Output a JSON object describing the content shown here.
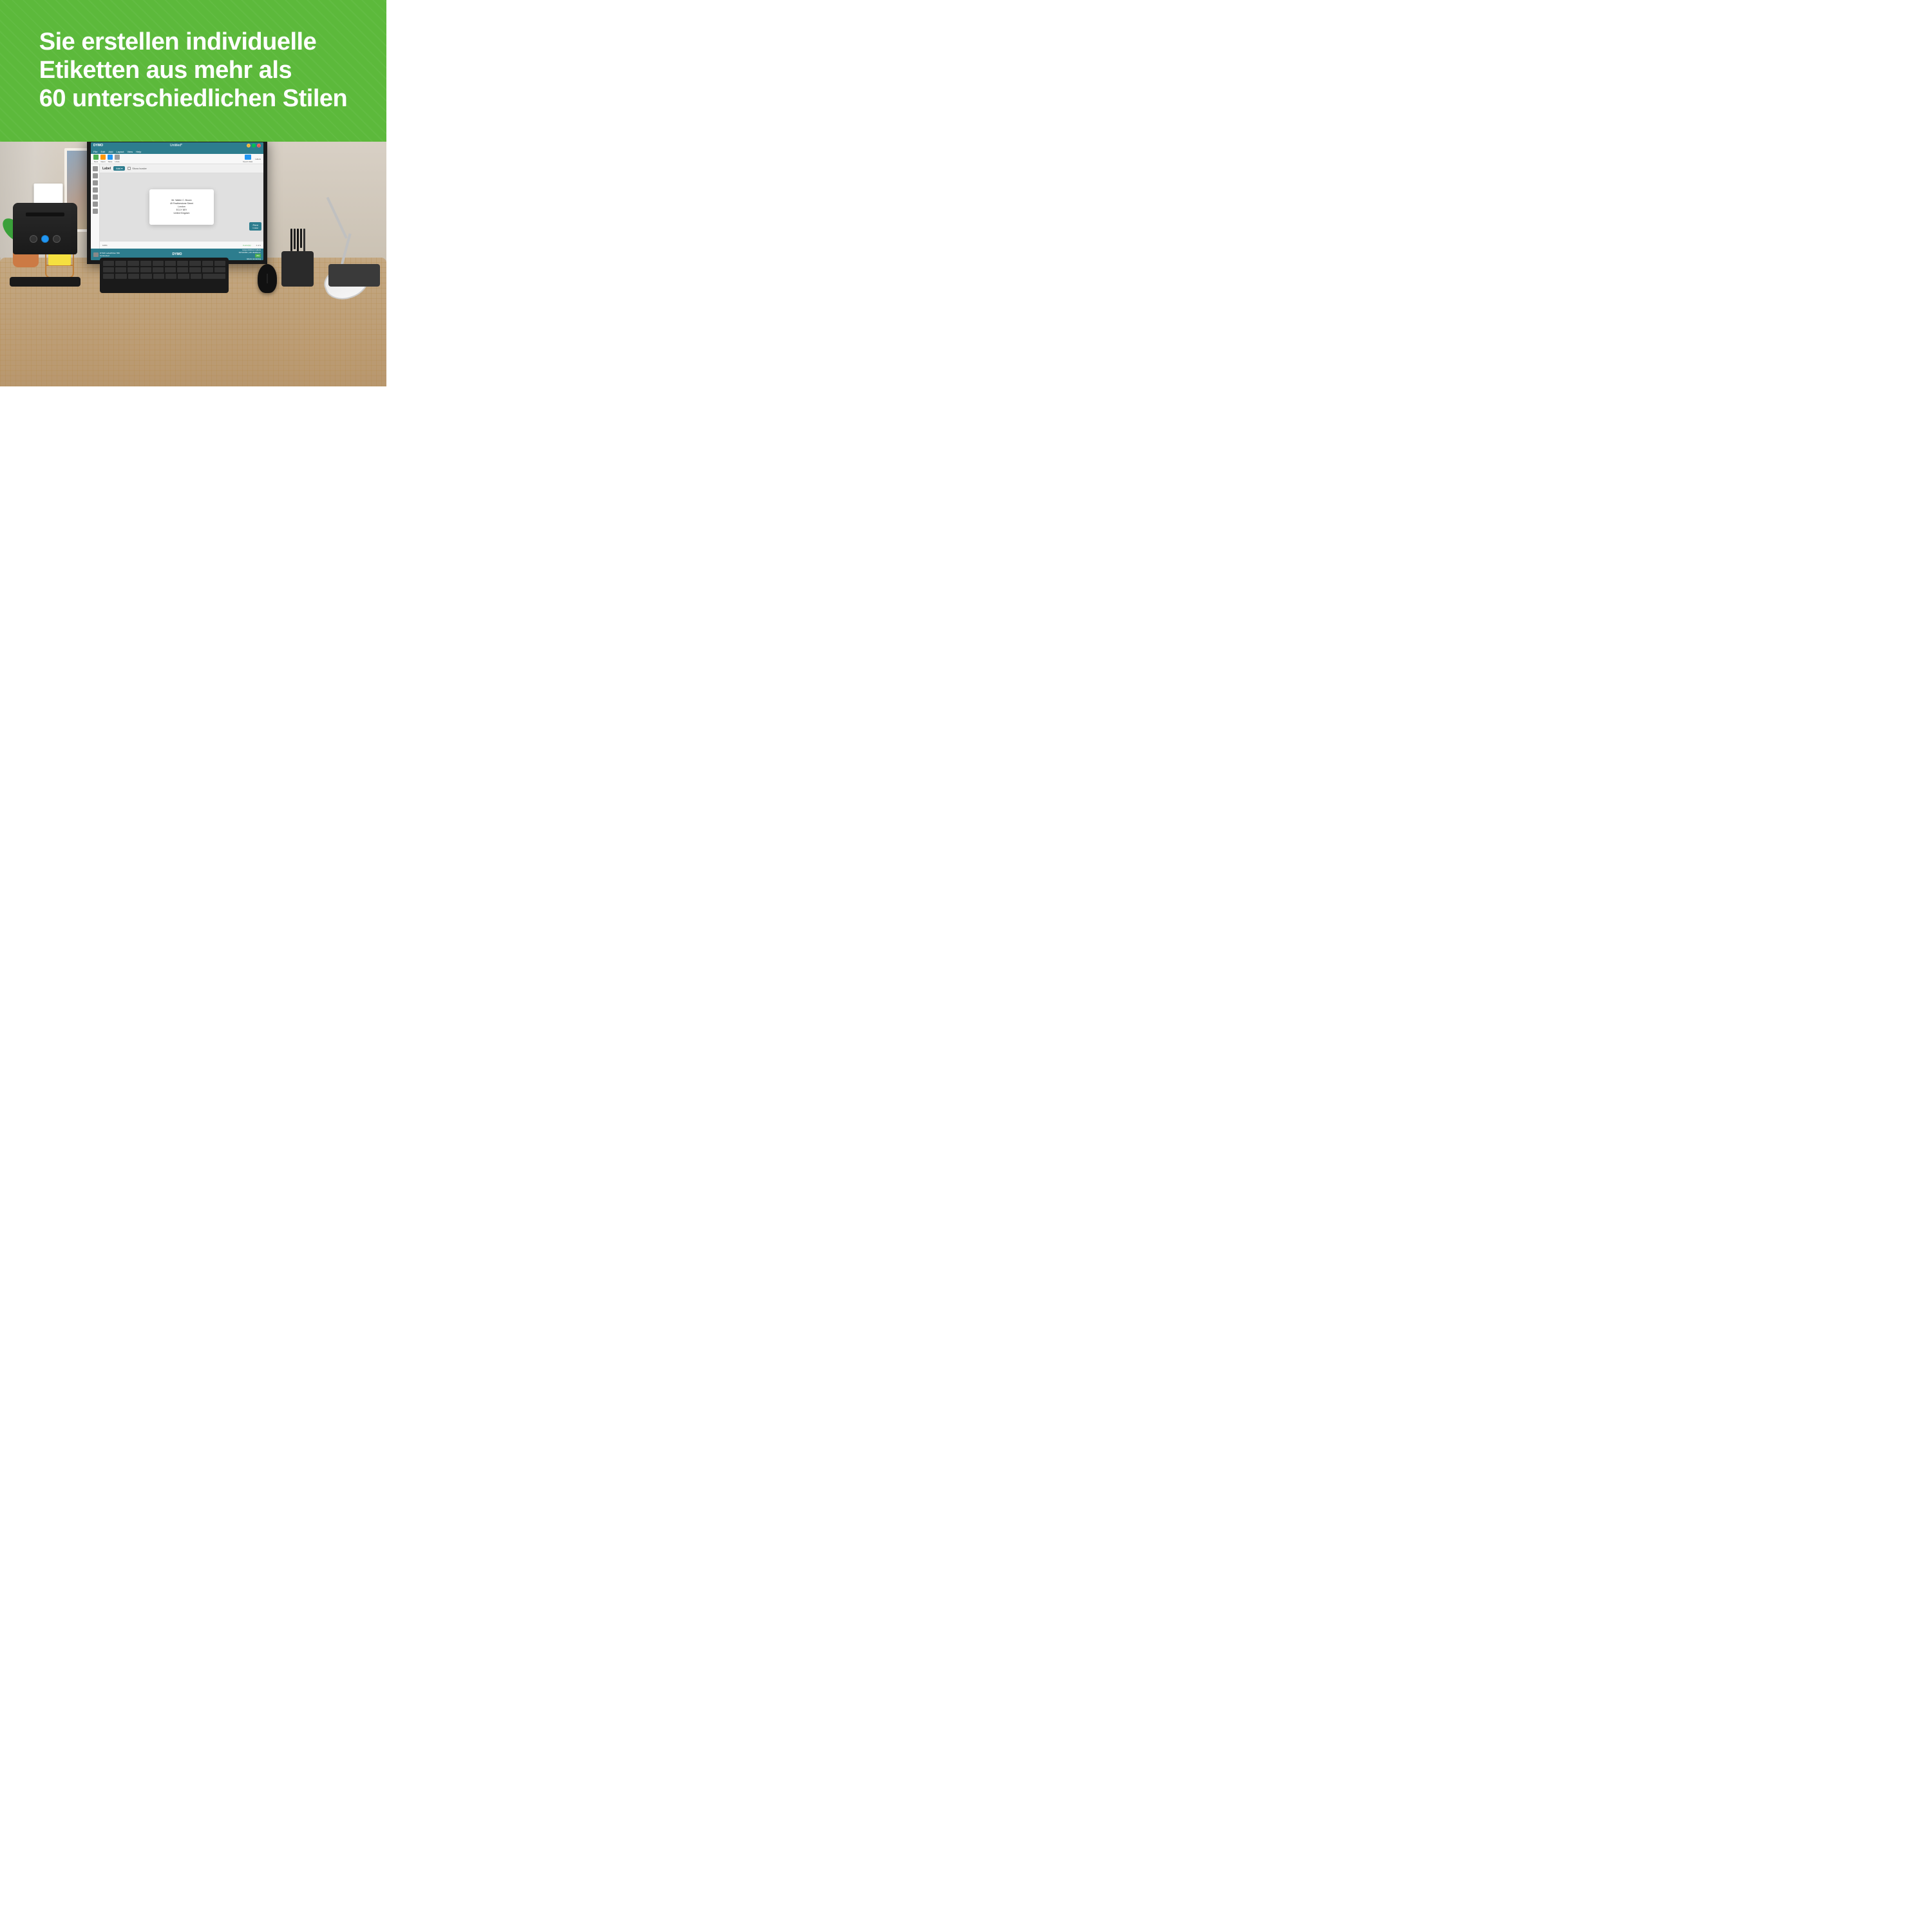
{
  "headline": {
    "line1": "Sie erstellen individuelle",
    "line2": "Etiketten aus mehr als",
    "line3": "60 unterschiedlichen Stilen"
  },
  "software": {
    "title": "Untitled*",
    "logo": "DYMO",
    "menu_items": [
      "File",
      "Edit",
      "Add",
      "Layout",
      "View",
      "Help"
    ],
    "toolbar": {
      "new_label": "New",
      "open_label": "Open",
      "save_label": "Save",
      "undo_label": "Undo",
      "redo_label": "Redo",
      "import_label": "Import data",
      "labels_label": "Labels"
    },
    "content": {
      "label_text": "Label",
      "add_btn": "Add",
      "show_border": "Show border",
      "address": "Mr. Walter C. Brown\n49 Featherstone Street\nLondon\nEC1Y 8SY\nUnited Kingdom"
    },
    "print_btn": "Print",
    "print_sub": "1 label",
    "zoom": "100%",
    "errors": "0 error(s)",
    "page": "1 of 1",
    "status": {
      "printer_name": "DYMO LabelWriter 550",
      "printer_status": "Connected",
      "label_type": "Large Address Labels",
      "label_code": "S0722400 | LW 36x89mm",
      "labels_remaining": "282",
      "labels_remaining_label": "labels remaining"
    }
  },
  "colors": {
    "green": "#5cb93b",
    "teal": "#2d7d8e",
    "white": "#ffffff"
  }
}
